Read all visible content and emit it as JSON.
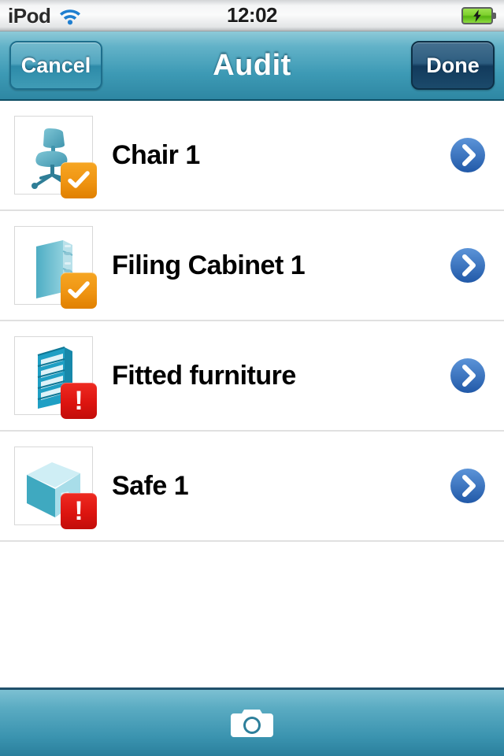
{
  "status_bar": {
    "carrier": "iPod",
    "wifi_icon": "wifi-icon",
    "time": "12:02",
    "battery_icon": "battery-charging-icon"
  },
  "nav_bar": {
    "title": "Audit",
    "cancel_label": "Cancel",
    "done_label": "Done"
  },
  "list": {
    "rows": [
      {
        "label": "Chair 1",
        "thumb_icon": "office-chair-icon",
        "badge": "check",
        "badge_icon": "checkmark-badge-icon",
        "disclosure_icon": "chevron-right-icon"
      },
      {
        "label": "Filing Cabinet 1",
        "thumb_icon": "filing-cabinet-icon",
        "badge": "check",
        "badge_icon": "checkmark-badge-icon",
        "disclosure_icon": "chevron-right-icon"
      },
      {
        "label": "Fitted furniture",
        "thumb_icon": "shelving-unit-icon",
        "badge": "alert",
        "badge_icon": "exclamation-badge-icon",
        "badge_glyph": "!",
        "disclosure_icon": "chevron-right-icon"
      },
      {
        "label": "Safe 1",
        "thumb_icon": "safe-icon",
        "badge": "alert",
        "badge_icon": "exclamation-badge-icon",
        "badge_glyph": "!",
        "disclosure_icon": "chevron-right-icon"
      }
    ]
  },
  "toolbar": {
    "camera_icon": "camera-icon"
  },
  "colors": {
    "nav_teal": "#3d9ab5",
    "done_navy": "#1b4a6b",
    "badge_orange": "#ef9412",
    "badge_red": "#dd1510",
    "disclosure_blue": "#2f6fc0",
    "thumb_teal": "#4ca8bf"
  }
}
